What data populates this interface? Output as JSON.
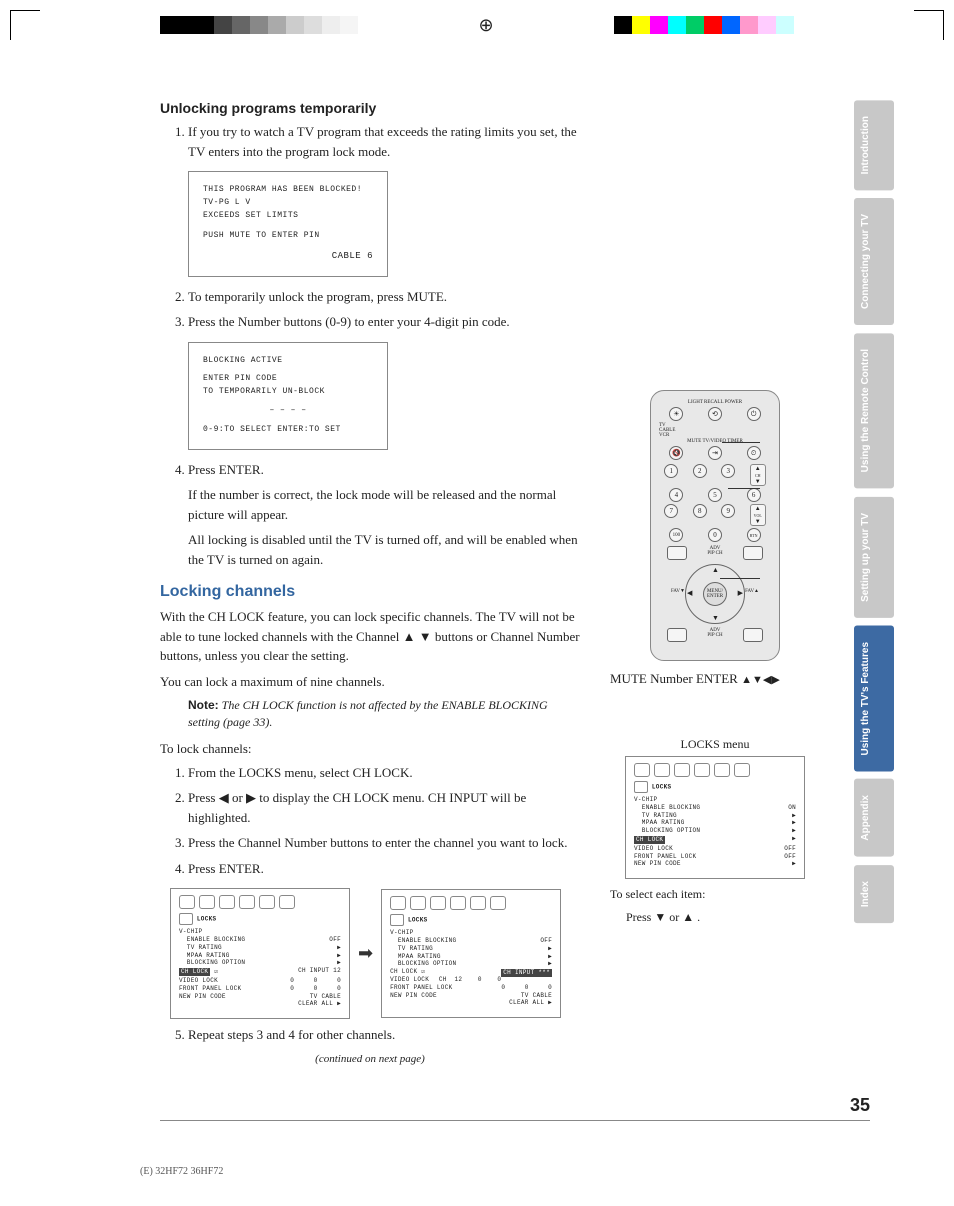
{
  "sections": {
    "unlock_title": "Unlocking programs temporarily",
    "unlock_steps": [
      "If you try to watch a TV program that exceeds the rating limits you set, the TV enters into the program lock mode.",
      "To temporarily unlock the program, press MUTE.",
      "Press the Number buttons (0-9) to enter your 4-digit pin code.",
      "Press ENTER."
    ],
    "unlock_follow": [
      "If the number is correct, the lock mode will be released and the normal picture will appear.",
      "All locking is disabled until the TV is turned off, and will be enabled when the TV is turned on again."
    ],
    "lock_title": "Locking channels",
    "lock_intro": "With the CH LOCK feature, you can lock specific channels. The TV will not be able to tune locked channels with the Channel ▲ ▼ buttons or Channel Number buttons, unless you clear the setting.",
    "lock_max": "You can lock a maximum of nine channels.",
    "note_label": "Note:",
    "note_text": "The CH LOCK function is not affected by the ENABLE BLOCKING setting (page 33).",
    "lock_steps_intro": "To lock channels:",
    "lock_steps": [
      "From the LOCKS menu, select CH LOCK.",
      "Press ◀ or ▶ to display the CH LOCK menu. CH INPUT will be highlighted.",
      "Press the Channel Number buttons to enter the channel you want to lock.",
      "Press ENTER.",
      "Repeat steps 3 and 4 for other channels."
    ],
    "continued": "(continued on next page)"
  },
  "screen1": {
    "l1": "THIS PROGRAM HAS BEEN BLOCKED!",
    "l2": "TV-PG   L   V",
    "l3": "EXCEEDS SET LIMITS",
    "l4": "PUSH MUTE TO ENTER PIN",
    "l5": "CABLE   6"
  },
  "screen2": {
    "l1": "BLOCKING ACTIVE",
    "l2": "ENTER PIN CODE",
    "l3": "TO TEMPORARILY UN-BLOCK",
    "l4": "– – – –",
    "l5": "0-9:TO SELECT  ENTER:TO SET"
  },
  "remote_labels": {
    "mute": "MUTE",
    "number": "Number",
    "enter": "ENTER",
    "arrows": "▲▼◀▶",
    "top": "LIGHT  RECALL  POWER",
    "tvcable": "TV\nCABLE\nVCR",
    "row2": "MUTE  TV/VIDEO  TIMER",
    "menu_enter": "MENU/\nENTER"
  },
  "locks_menu": {
    "title": "LOCKS menu",
    "header": "LOCKS",
    "vchip": "V-CHIP",
    "enable": "  ENABLE BLOCKING",
    "on": "ON",
    "off": "OFF",
    "tvrating": "  TV RATING",
    "mpaa": "  MPAA RATING",
    "blockopt": "  BLOCKING OPTION",
    "chlock": "CH LOCK",
    "videolock": "VIDEO LOCK",
    "frontpanel": "FRONT PANEL LOCK",
    "newpin": "NEW PIN CODE",
    "ch_input": "CH  INPUT  12",
    "ch_input2": "CH  INPUT  ***",
    "zeros": "0     0     0",
    "tvcable": "TV CABLE",
    "clearall": "CLEAR ALL",
    "ch12": "CH  12    0    0",
    "select": "To select each item:",
    "press": "Press ▼ or ▲ ."
  },
  "tabs": [
    "Introduction",
    "Connecting your TV",
    "Using the Remote Control",
    "Setting up your TV",
    "Using the TV's Features",
    "Appendix",
    "Index"
  ],
  "page_number": "35",
  "footer_model": "(E) 32HF72  36HF72"
}
